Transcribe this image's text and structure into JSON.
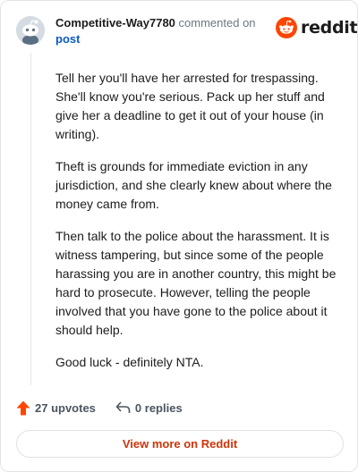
{
  "header": {
    "author": "Competitive-Way7780",
    "action_text": "commented on",
    "post_link": "post",
    "brand": "reddit"
  },
  "comment": {
    "paragraphs": [
      "Tell her you'll have her arrested for trespassing. She'll know you're serious. Pack up her stuff and give her a deadline to get it out of your house (in writing).",
      "Theft is grounds for immediate eviction in any jurisdiction, and she clearly knew about where the money came from.",
      "Then talk to the police about the harassment. It is witness tampering, but since some of the people harassing you are in another country, this might be hard to prosecute. However, telling the people involved that you have gone to the police about it should help.",
      "Good luck - definitely NTA."
    ]
  },
  "footer": {
    "upvotes": "27 upvotes",
    "replies": "0 replies",
    "view_more": "View more on Reddit"
  },
  "colors": {
    "brand_orange": "#ff4500",
    "upvote_orange": "#ff4500",
    "link_blue": "#0a5ac2",
    "view_more_red": "#cf3409"
  },
  "icons": {
    "avatar": "snoo-avatar-icon",
    "brand": "reddit-logo-icon",
    "upvote": "upvote-arrow-icon",
    "reply": "reply-arrow-icon"
  }
}
